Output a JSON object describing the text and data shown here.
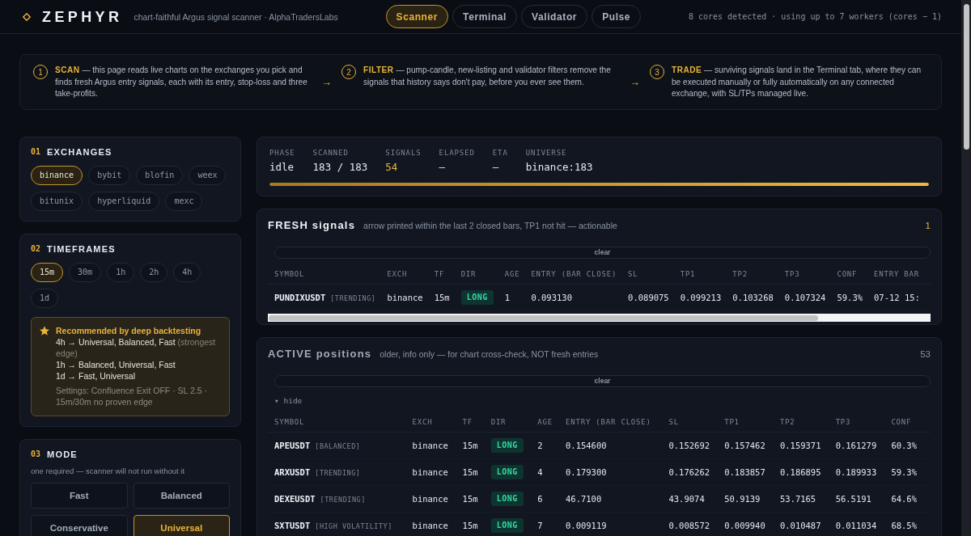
{
  "header": {
    "logo": "ZEPHYR",
    "tagline": "chart-faithful Argus signal scanner · AlphaTradersLabs",
    "nav": [
      {
        "label": "Scanner",
        "selected": true
      },
      {
        "label": "Terminal",
        "selected": false
      },
      {
        "label": "Validator",
        "selected": false
      },
      {
        "label": "Pulse",
        "selected": false
      }
    ],
    "cores_note": "8 cores detected · using up to 7 workers (cores − 1)"
  },
  "steps": [
    {
      "number": "1",
      "text": "**SCAN** — this page reads live charts on the exchanges you pick and finds fresh Argus entry signals, each with its entry, stop-loss and three take-profits."
    },
    {
      "arrow": "→",
      "number": "2",
      "text": "**FILTER** — pump-candle, new-listing and validator filters remove the signals that history says don't pay, before you ever see them."
    },
    {
      "arrow": "→",
      "number": "3",
      "text": "**TRADE** — surviving signals land in the Terminal tab, where they can be executed manually or fully automatically on any connected exchange, with SL/TPs managed live."
    }
  ],
  "sidebar": {
    "exchanges": {
      "number": "01",
      "title": "EXCHANGES",
      "options": [
        {
          "label": "binance",
          "selected": true
        },
        {
          "label": "bybit",
          "selected": false
        },
        {
          "label": "blofin",
          "selected": false
        },
        {
          "label": "weex",
          "selected": false
        },
        {
          "label": "bitunix",
          "selected": false
        },
        {
          "label": "hyperliquid",
          "selected": false
        },
        {
          "label": "mexc",
          "selected": false
        }
      ]
    },
    "timeframes": {
      "number": "02",
      "title": "TIMEFRAMES",
      "options": [
        {
          "label": "15m",
          "selected": true
        },
        {
          "label": "30m",
          "selected": false
        },
        {
          "label": "1h",
          "selected": false
        },
        {
          "label": "2h",
          "selected": false
        },
        {
          "label": "4h",
          "selected": false
        },
        {
          "label": "1d",
          "selected": false
        }
      ],
      "recommendation": {
        "title": "Recommended by deep backtesting",
        "lines": [
          {
            "text": "4h → Universal, Balanced, Fast",
            "note": "(strongest edge)"
          },
          {
            "text": "1h → Balanced, Universal, Fast"
          },
          {
            "text": "1d → Fast, Universal"
          }
        ],
        "settings": "Settings: Confluence Exit OFF · SL 2.5 · 15m/30m no proven edge"
      }
    },
    "mode": {
      "number": "03",
      "title": "MODE",
      "hint": "one required — scanner will not run without it",
      "options": [
        {
          "label": "Fast",
          "selected": false
        },
        {
          "label": "Balanced",
          "selected": false
        },
        {
          "label": "Conservative",
          "selected": false
        },
        {
          "label": "Universal",
          "selected": true
        }
      ]
    }
  },
  "stats": {
    "fields": [
      {
        "label": "PHASE",
        "value": "idle",
        "accent": false
      },
      {
        "label": "SCANNED",
        "value": "183 / 183",
        "accent": false
      },
      {
        "label": "SIGNALS",
        "value": "54",
        "accent": true
      },
      {
        "label": "ELAPSED",
        "value": "–",
        "accent": false
      },
      {
        "label": "ETA",
        "value": "–",
        "accent": false
      },
      {
        "label": "UNIVERSE",
        "value": "binance:183",
        "accent": false
      }
    ],
    "progress": {
      "level": 1
    }
  },
  "signal_tables": [
    {
      "kind": "fresh",
      "title": "FRESH signals",
      "subtitle": "arrow printed within the last 2 closed bars, TP1 not hit — actionable",
      "count": "1",
      "clear_label": "clear",
      "columns": [
        "SYMBOL",
        "EXCH",
        "TF",
        "DIR",
        "AGE",
        "ENTRY (BAR CLOSE)",
        "SL",
        "TP1",
        "TP2",
        "TP3",
        "CONF",
        "ENTRY BAR"
      ],
      "rows": [
        {
          "symbol": "PUNDIXUSDT",
          "regime": "[TRENDING]",
          "exchange": "binance",
          "timeframe": "15m",
          "direction": "LONG",
          "age": "1",
          "entry": "0.093130",
          "sl": "0.089075",
          "tp1": "0.099213",
          "tp2": "0.103268",
          "tp3": "0.107324",
          "conf": "59.3%",
          "entry_bar": "07-12 15:"
        }
      ]
    },
    {
      "kind": "active",
      "title": "ACTIVE positions",
      "subtitle": "older, info only — for chart cross-check, NOT fresh entries",
      "count": "53",
      "clear_label": "clear",
      "toggle_label": "▾ hide",
      "columns": [
        "SYMBOL",
        "EXCH",
        "TF",
        "DIR",
        "AGE",
        "ENTRY (BAR CLOSE)",
        "SL",
        "TP1",
        "TP2",
        "TP3",
        "CONF"
      ],
      "rows": [
        {
          "symbol": "APEUSDT",
          "regime": "[BALANCED]",
          "exchange": "binance",
          "timeframe": "15m",
          "direction": "LONG",
          "age": "2",
          "entry": "0.154600",
          "sl": "0.152692",
          "tp1": "0.157462",
          "tp2": "0.159371",
          "tp3": "0.161279",
          "conf": "60.3%"
        },
        {
          "symbol": "ARXUSDT",
          "regime": "[TRENDING]",
          "exchange": "binance",
          "timeframe": "15m",
          "direction": "LONG",
          "age": "4",
          "entry": "0.179300",
          "sl": "0.176262",
          "tp1": "0.183857",
          "tp2": "0.186895",
          "tp3": "0.189933",
          "conf": "59.3%"
        },
        {
          "symbol": "DEXEUSDT",
          "regime": "[TRENDING]",
          "exchange": "binance",
          "timeframe": "15m",
          "direction": "LONG",
          "age": "6",
          "entry": "46.7100",
          "sl": "43.9074",
          "tp1": "50.9139",
          "tp2": "53.7165",
          "tp3": "56.5191",
          "conf": "64.6%"
        },
        {
          "symbol": "SXTUSDT",
          "regime": "[HIGH VOLATILITY]",
          "exchange": "binance",
          "timeframe": "15m",
          "direction": "LONG",
          "age": "7",
          "entry": "0.009119",
          "sl": "0.008572",
          "tp1": "0.009940",
          "tp2": "0.010487",
          "tp3": "0.011034",
          "conf": "68.5%"
        }
      ]
    }
  ]
}
